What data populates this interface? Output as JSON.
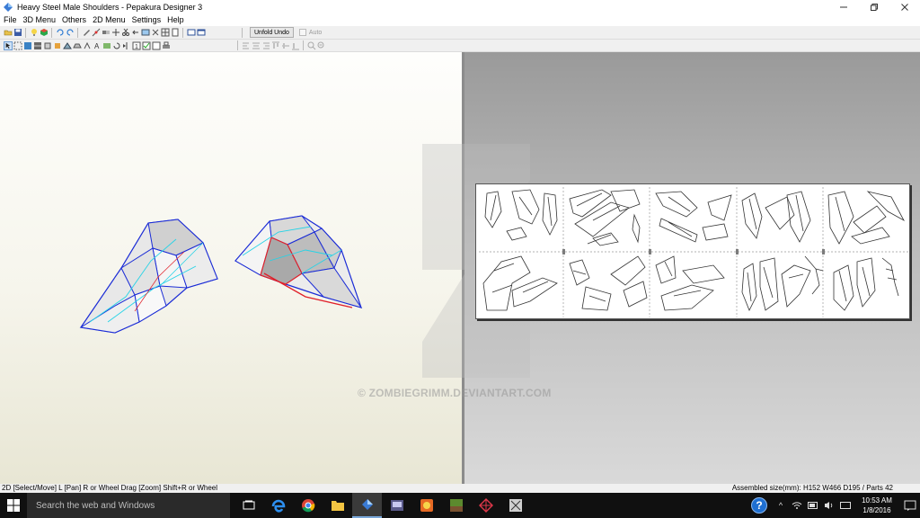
{
  "window": {
    "title": "Heavy Steel Male Shoulders - Pepakura Designer 3",
    "controls": [
      "minimize",
      "maximize",
      "close"
    ]
  },
  "menu": [
    "File",
    "3D Menu",
    "Others",
    "2D Menu",
    "Settings",
    "Help"
  ],
  "toolbar": {
    "unfold_undo": "Unfold Undo",
    "auto_label": "Auto"
  },
  "watermark": "© ZOMBIEGRIMM.DEVIANTART.COM",
  "status": {
    "left": "2D [Select/Move] L [Pan] R or Wheel Drag [Zoom] Shift+R or Wheel",
    "right": "Assembled size(mm): H152 W466 D195 / Parts 42"
  },
  "taskbar": {
    "search_placeholder": "Search the web and Windows",
    "time": "10:53 AM",
    "date": "1/8/2016",
    "apps": [
      "task-view-icon",
      "edge-icon",
      "chrome-icon",
      "file-explorer-icon",
      "pepakura-icon",
      "media-icon",
      "game-icon",
      "minecraft-icon",
      "app-icon",
      "app2-icon"
    ]
  },
  "colors": {
    "accent_blue": "#1a2bd6",
    "edge_cyan": "#25d3e6",
    "fold_red": "#e0202a",
    "taskbar": "#101010"
  }
}
